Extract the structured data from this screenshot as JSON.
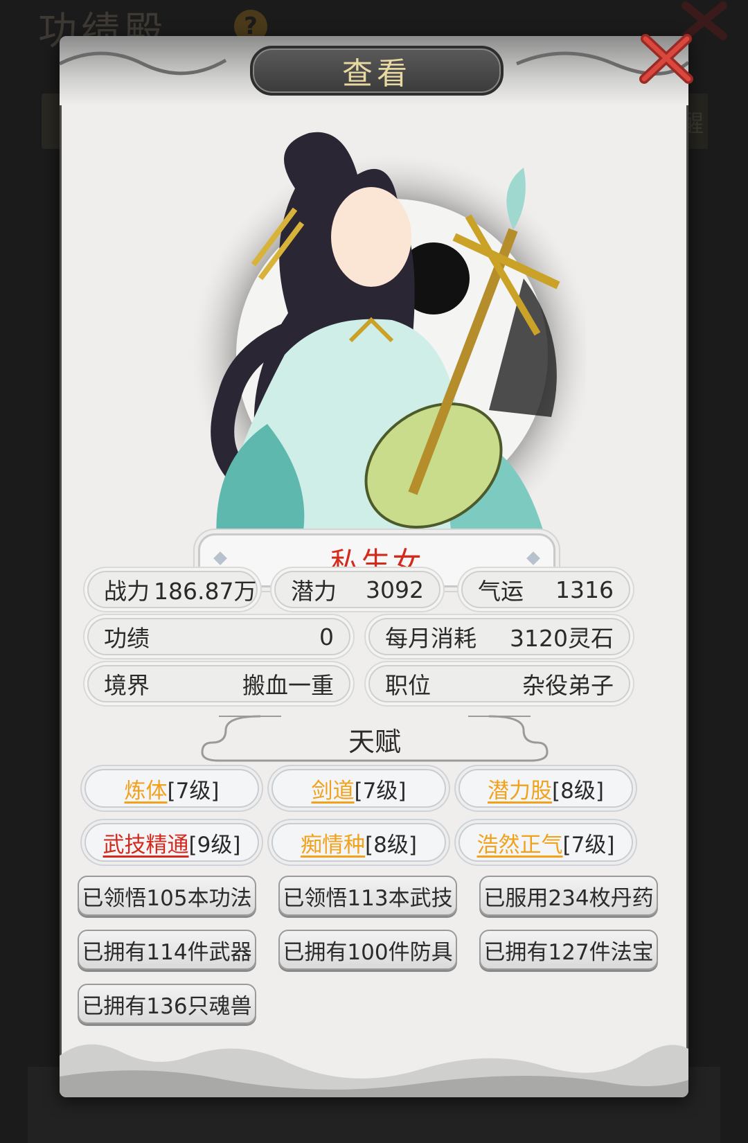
{
  "background": {
    "title": "功绩殿",
    "help_icon": "?",
    "right_char": "醒"
  },
  "dialog": {
    "title": "查看",
    "close_icon": "close-x-icon",
    "accent_color": "#d42a1e",
    "talent_gold": "#f0a21c",
    "character": {
      "name": "私生女"
    },
    "stats": {
      "power_label": "战力",
      "power_value": "186.87万",
      "potential_label": "潜力",
      "potential_value": "3092",
      "luck_label": "气运",
      "luck_value": "1316",
      "merit_label": "功绩",
      "merit_value": "0",
      "monthly_label": "每月消耗",
      "monthly_value": "3120灵石",
      "realm_label": "境界",
      "realm_value": "搬血一重",
      "position_label": "职位",
      "position_value": "杂役弟子"
    },
    "talent_heading": "天赋",
    "talents": [
      {
        "name": "炼体",
        "level": "[7级]",
        "color": "gold"
      },
      {
        "name": "剑道",
        "level": "[7级]",
        "color": "gold"
      },
      {
        "name": "潜力股",
        "level": "[8级]",
        "color": "gold"
      },
      {
        "name": "武技精通",
        "level": "[9级]",
        "color": "red"
      },
      {
        "name": "痴情种",
        "level": "[8级]",
        "color": "gold"
      },
      {
        "name": "浩然正气",
        "level": "[7级]",
        "color": "gold"
      }
    ],
    "records": [
      "已领悟105本功法",
      "已领悟113本武技",
      "已服用234枚丹药",
      "已拥有114件武器",
      "已拥有100件防具",
      "已拥有127件法宝",
      "已拥有136只魂兽"
    ]
  }
}
